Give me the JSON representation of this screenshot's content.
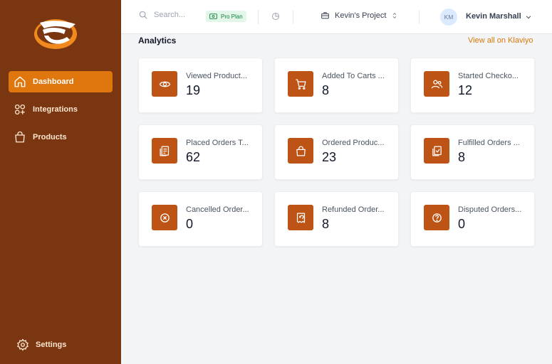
{
  "sidebar": {
    "items": [
      {
        "label": "Dashboard",
        "icon": "home-icon",
        "active": true
      },
      {
        "label": "Integrations",
        "icon": "apps-add-icon"
      },
      {
        "label": "Products",
        "icon": "shopping-bag-icon"
      }
    ],
    "settings_label": "Settings",
    "settings_icon": "gear-icon"
  },
  "header": {
    "search_placeholder": "Search...",
    "plan_badge": "Pro Plan",
    "project_name": "Kevin's Project",
    "user_initials": "KM",
    "user_name": "Kevin Marshall"
  },
  "main": {
    "title": "Analytics",
    "view_all_label": "View all on Klaviyo",
    "cards": [
      {
        "label": "Viewed Product...",
        "value": "19",
        "icon": "eye-icon"
      },
      {
        "label": "Added To Carts ...",
        "value": "8",
        "icon": "cart-icon"
      },
      {
        "label": "Started Checko...",
        "value": "12",
        "icon": "users-icon"
      },
      {
        "label": "Placed Orders T...",
        "value": "62",
        "icon": "receipt-icon"
      },
      {
        "label": "Ordered Produc...",
        "value": "23",
        "icon": "bag-icon"
      },
      {
        "label": "Fulfilled Orders ...",
        "value": "8",
        "icon": "clipboard-check-icon"
      },
      {
        "label": "Cancelled Order...",
        "value": "0",
        "icon": "x-circle-icon"
      },
      {
        "label": "Refunded Order...",
        "value": "8",
        "icon": "receipt-refund-icon"
      },
      {
        "label": "Disputed Orders...",
        "value": "0",
        "icon": "question-circle-icon"
      }
    ]
  },
  "colors": {
    "sidebar_bg": "#7a3610",
    "accent": "#e0770e",
    "card_icon_bg": "#bd5314",
    "link": "#d97706"
  }
}
